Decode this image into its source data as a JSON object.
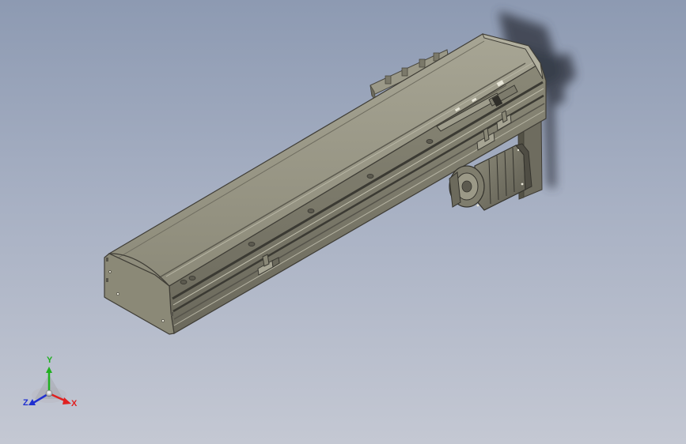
{
  "triad": {
    "x_label": "X",
    "y_label": "Y",
    "z_label": "Z"
  },
  "colors": {
    "background_top": "#8d9ab2",
    "background_bottom": "#c4c8d3",
    "model_body": "#8f8d7c",
    "model_dark": "#4f4d44",
    "shadow": "#3d4350",
    "axis_x": "#e02020",
    "axis_y": "#20b020",
    "axis_z": "#2030d0"
  }
}
